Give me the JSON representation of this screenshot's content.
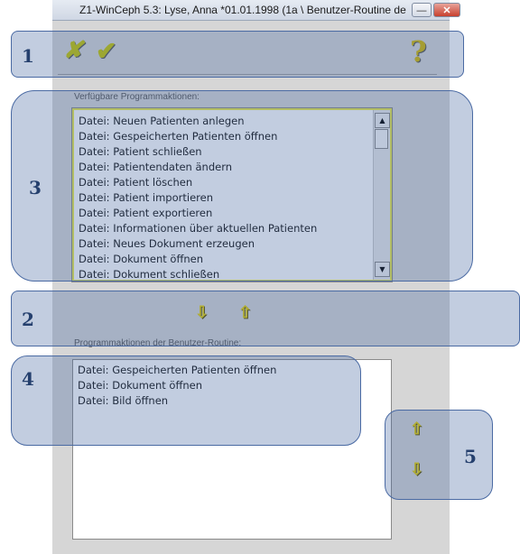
{
  "window": {
    "title": "Z1-WinCeph 5.3: Lyse, Anna *01.01.1998 (1a \\ Benutzer-Routine def",
    "minimize_glyph": "—",
    "close_glyph": "✕"
  },
  "toolbar": {
    "cancel_icon": "✘",
    "ok_icon": "✔",
    "help_icon": "?"
  },
  "available": {
    "label": "Verfügbare Programmaktionen:",
    "items": [
      "Datei: Neuen Patienten anlegen",
      "Datei: Gespeicherten Patienten öffnen",
      "Datei: Patient schließen",
      "Datei: Patientendaten ändern",
      "Datei: Patient löschen",
      "Datei: Patient importieren",
      "Datei: Patient exportieren",
      "Datei: Informationen über aktuellen Patienten",
      "Datei: Neues Dokument erzeugen",
      "Datei: Dokument öffnen",
      "Datei: Dokument schließen"
    ],
    "scroll_up": "▲",
    "scroll_down": "▼"
  },
  "transfer": {
    "add_icon": "⇩",
    "remove_icon": "⇧"
  },
  "routine": {
    "label": "Programmaktionen der Benutzer-Routine:",
    "items": [
      "Datei: Gespeicherten Patienten öffnen",
      "Datei: Dokument öffnen",
      "Datei: Bild öffnen"
    ],
    "move_up_icon": "⇧",
    "move_down_icon": "⇩"
  },
  "callouts": [
    "1",
    "2",
    "3",
    "4",
    "5"
  ],
  "colors": {
    "callout_fill": "#4063a0",
    "icon_yellow": "#e8d200"
  }
}
